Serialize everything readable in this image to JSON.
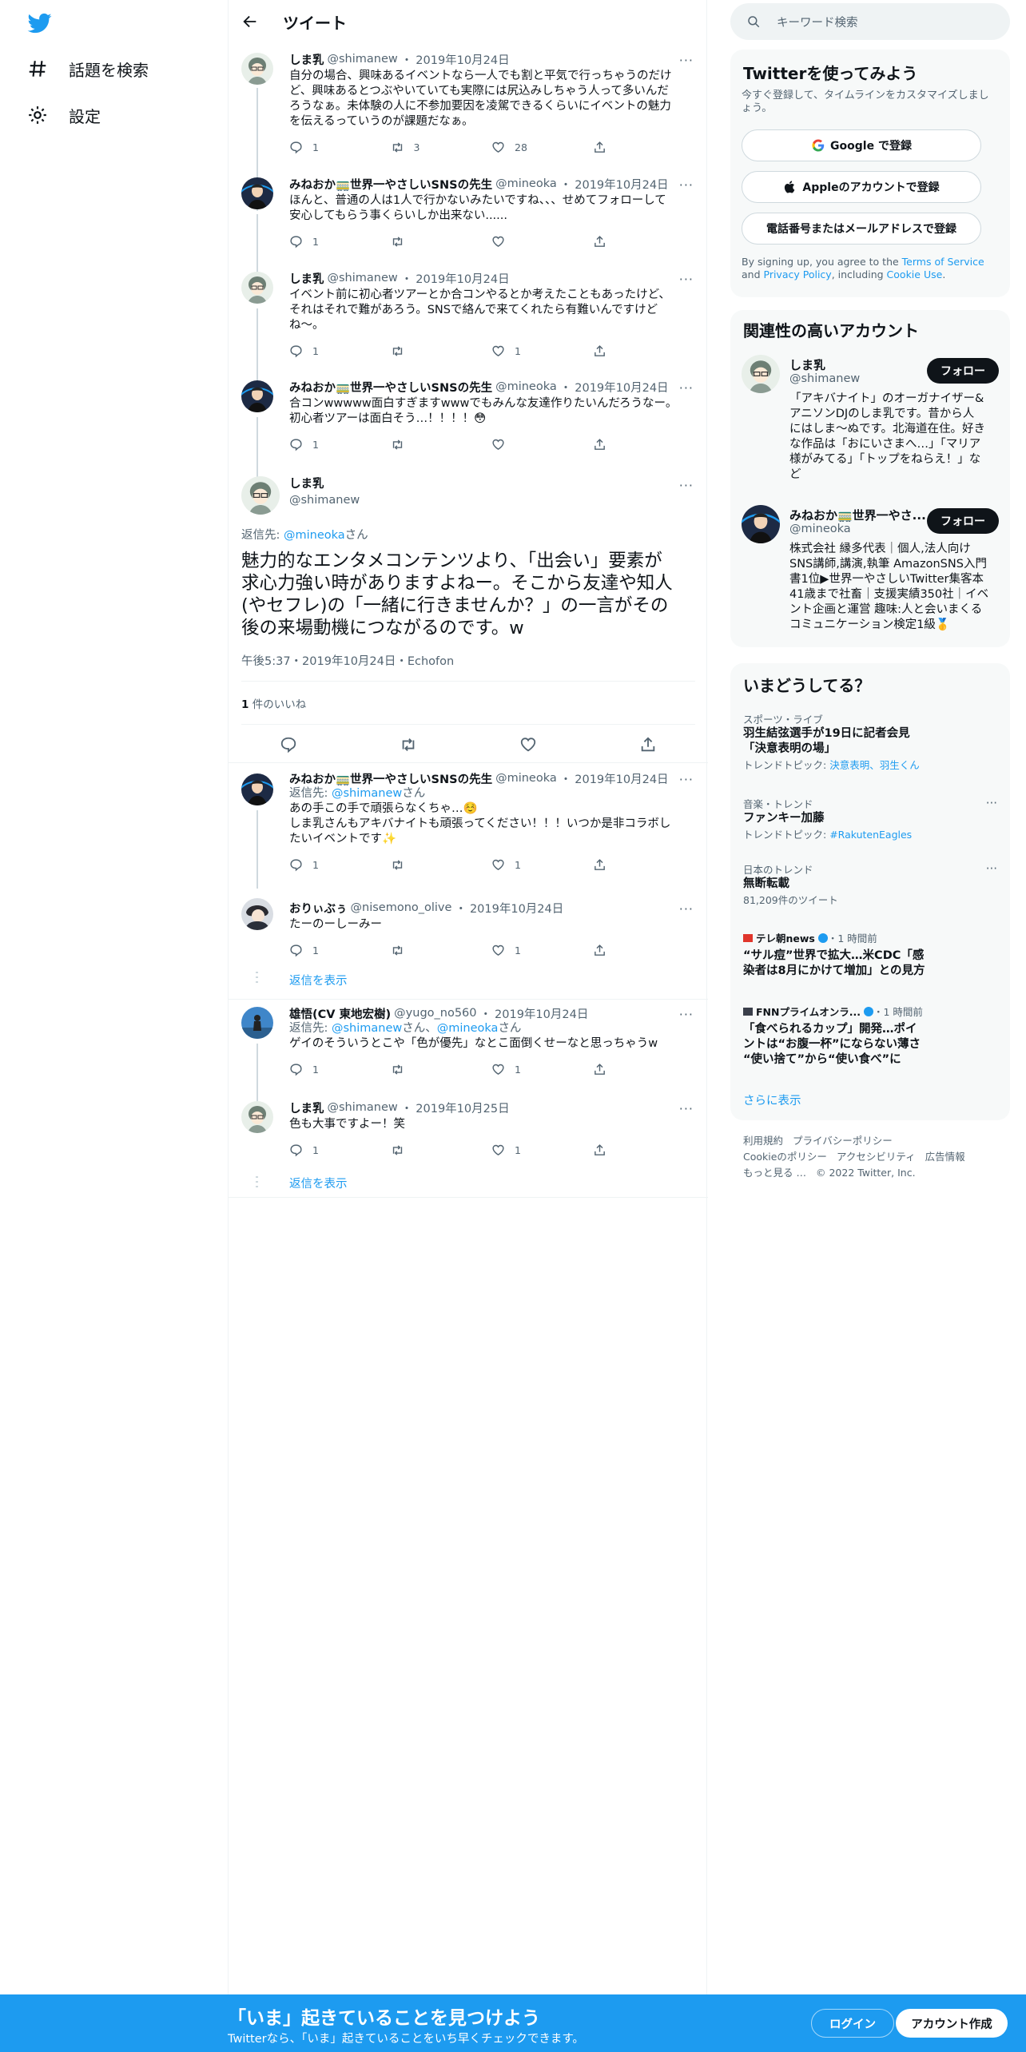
{
  "nav": {
    "explore": "話題を検索",
    "settings": "設定"
  },
  "header": {
    "title": "ツイート"
  },
  "thread": [
    {
      "name": "しま乳",
      "handle": "@shimanew",
      "date": "2019年10月24日",
      "lines": [
        "自分の場合、興味あるイベントなら一人でも割と平気で行っちゃうのだけ",
        "ど、興味あるとつぶやいていても実際には尻込みしちゃう人って多いんだ",
        "ろうなぁ。未体験の人に不参加要因を凌駕できるくらいにイベントの魅力",
        "を伝えるっていうのが課題だなぁ。"
      ],
      "reply": "1",
      "retweet": "3",
      "like": "28"
    },
    {
      "name": "みねおか🚃世界一やさしいSNSの先生",
      "handle": "@mineoka",
      "date": "2019年10月24日",
      "lines": [
        "ほんと、普通の人は1人で行かないみたいですね、、、せめてフォローして",
        "安心してもらう事くらいしか出来ない......"
      ],
      "reply": "1",
      "retweet": "",
      "like": ""
    },
    {
      "name": "しま乳",
      "handle": "@shimanew",
      "date": "2019年10月24日",
      "lines": [
        "イベント前に初心者ツアーとか合コンやるとか考えたこともあったけど、",
        "それはそれで難があろう。SNSで絡んで来てくれたら有難いんですけど",
        "ね〜。"
      ],
      "reply": "1",
      "retweet": "",
      "like": "1"
    },
    {
      "name": "みねおか🚃世界一やさしいSNSの先生",
      "handle": "@mineoka",
      "date": "2019年10月24日",
      "lines": [
        "合コンwwwww面白すぎますwwwでもみんな友達作りたいんだろうなー。",
        "初心者ツアーは面白そう…！！！！😳"
      ],
      "reply": "1",
      "retweet": "",
      "like": ""
    }
  ],
  "main": {
    "name": "しま乳",
    "handle": "@shimanew",
    "reply_prefix": "返信先: ",
    "reply_to": "@mineoka",
    "reply_suffix": "さん",
    "lines": [
      "魅力的なエンタメコンテンツより、「出会い」要素が",
      "求心力強い時がありますよねー。そこから友達や知人",
      "(やセフレ)の「一緒に行きませんか？」の一言がその",
      "後の来場動機につながるのです。w"
    ],
    "meta": "午後5:37・2019年10月24日・Echofon",
    "like_count": "1",
    "like_label": "件のいいね"
  },
  "replies": [
    {
      "name": "みねおか🚃世界一やさしいSNSの先生",
      "handle": "@mineoka",
      "date": "2019年10月24日",
      "reply_prefix": "返信先: ",
      "reply_to": "@shimanew",
      "reply_to2": "",
      "reply_suffix": "さん",
      "lines": [
        "あの手この手で頑張らなくちゃ…☺️",
        "しま乳さんもアキバナイトも頑張ってください！！！いつか是非コラボし",
        "たいイベントです✨"
      ],
      "reply": "1",
      "retweet": "",
      "like": "1"
    },
    {
      "name": "おりぃぶぅ",
      "handle": "@nisemono_olive",
      "date": "2019年10月24日",
      "lines": [
        "たーのーしーみー"
      ],
      "reply": "1",
      "retweet": "",
      "like": "1",
      "show_replies": "返信を表示"
    },
    {
      "name": "雄悟(CV 東地宏樹)",
      "handle": "@yugo_no560",
      "date": "2019年10月24日",
      "reply_prefix": "返信先: ",
      "reply_to": "@shimanew",
      "reply_to2": "@mineoka",
      "reply_suffix": "さん",
      "lines": [
        "ゲイのそういうとこや「色が優先」なとこ面倒くせーなと思っちゃうw"
      ],
      "reply": "1",
      "retweet": "",
      "like": "1"
    },
    {
      "name": "しま乳",
      "handle": "@shimanew",
      "date": "2019年10月25日",
      "lines": [
        "色も大事ですよー！笑"
      ],
      "reply": "1",
      "retweet": "",
      "like": "1",
      "show_replies": "返信を表示"
    }
  ],
  "search": {
    "placeholder": "キーワード検索"
  },
  "signup": {
    "title": "Twitterを使ってみよう",
    "subtitle": "今すぐ登録して、タイムラインをカスタマイズしましょう。",
    "google": "Google で登録",
    "apple": "Appleのアカウントで登録",
    "phone": "電話番号またはメールアドレスで登録",
    "fine_1": "By signing up, you agree to the ",
    "tos": "Terms of Service",
    "fine_2": " and ",
    "privacy": "Privacy Policy",
    "fine_3": ", including ",
    "cookie": "Cookie Use",
    "fine_4": "."
  },
  "related": {
    "title": "関連性の高いアカウント",
    "accounts": [
      {
        "name": "しま乳",
        "handle": "@shimanew",
        "follow": "フォロー",
        "bio": [
          "「アキバナイト」のオーガナイザー&",
          "アニソンDJのしま乳です。昔から人",
          "にはしま〜ぬです。北海道在住。好き",
          "な作品は「おにいさまへ…」「マリア",
          "様がみてる」「トップをねらえ！」な",
          "ど"
        ]
      },
      {
        "name": "みねおか🚃世界一やさ...",
        "handle": "@mineoka",
        "follow": "フォロー",
        "bio": [
          "株式会社 縁多代表｜個人,法人向け",
          "SNS講師,講演,執筆 AmazonSNS入門",
          "書1位▶世界一やさしいTwitter集客本",
          "41歳まで社畜｜支援実績350社｜イベ",
          "ント企画と運営 趣味:人と会いまくる",
          "コミュニケーション検定1級🥇"
        ]
      }
    ]
  },
  "trends": {
    "title": "いまどうしてる？",
    "items": [
      {
        "category": "スポーツ・ライブ",
        "lines": [
          "羽生結弦選手が19日に記者会見",
          "「決意表明の場」"
        ],
        "meta_prefix": "トレンドトピック: ",
        "meta_link": "決意表明、羽生くん"
      },
      {
        "category": "音楽・トレンド",
        "lines": [
          "ファンキー加藤"
        ],
        "meta_prefix": "トレンドトピック: ",
        "meta_link": "#RakutenEagles"
      },
      {
        "category": "日本のトレンド",
        "lines": [
          "無断転載"
        ],
        "meta_prefix": "81,209件のツイート",
        "meta_link": ""
      },
      {
        "category": "テレ朝news",
        "time": "・1 時間前",
        "lines": [
          "“サル痘”世界で拡大…米CDC「感",
          "染者は8月にかけて増加」との見方"
        ]
      },
      {
        "category": "FNNプライムオンラ...",
        "time": "・1 時間前",
        "lines": [
          "「食べられるカップ」開発…ポイ",
          "ントは“お腹一杯”にならない薄さ",
          "“使い捨て”から“使い食べ”に"
        ]
      }
    ],
    "show_more": "さらに表示"
  },
  "footer": {
    "terms": "利用規約",
    "privacy": "プライバシーポリシー",
    "cookie": "Cookieのポリシー",
    "access": "アクセシビリティ",
    "ads": "広告情報",
    "more": "もっと見る …",
    "copy": "© 2022 Twitter, Inc."
  },
  "bottom": {
    "title": "「いま」起きていることを見つけよう",
    "subtitle": "Twitterなら、「いま」起きていることをいち早くチェックできます。",
    "login": "ログイン",
    "signup": "アカウント作成"
  },
  "colors": {
    "accent": "#1d9bf0",
    "text": "#0f1419",
    "secondary": "#536471"
  }
}
